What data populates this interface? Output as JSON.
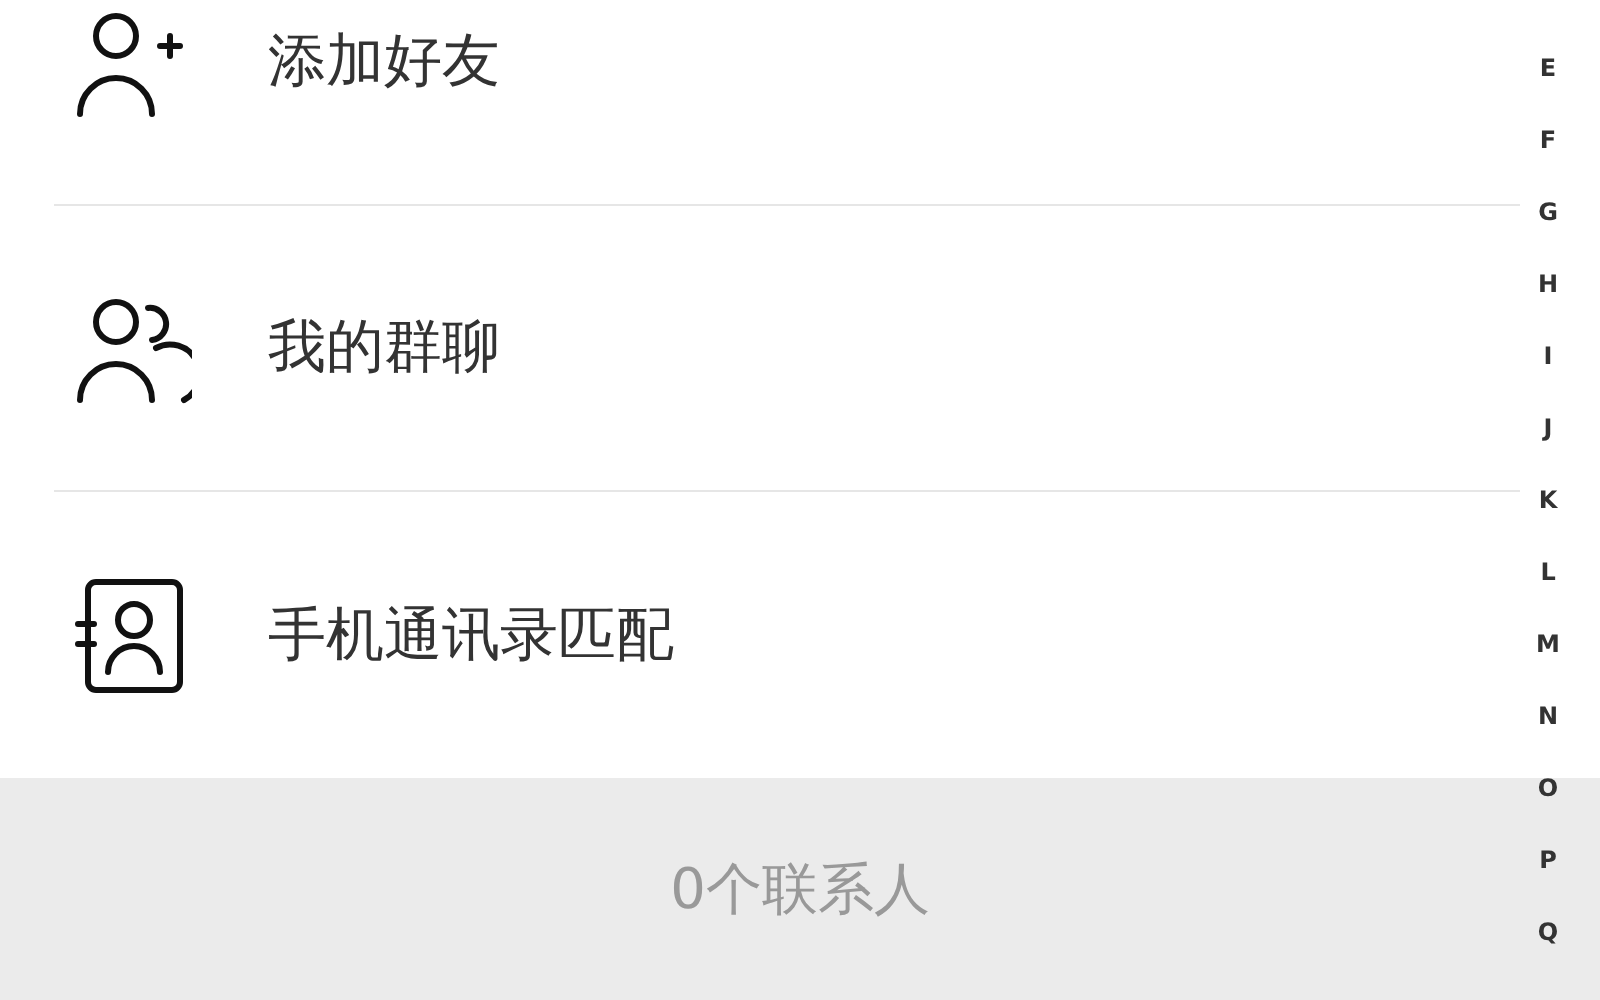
{
  "menu_items": [
    {
      "kind": "add-friend",
      "label": "添加好友"
    },
    {
      "kind": "group-chat",
      "label": "我的群聊"
    },
    {
      "kind": "contacts",
      "label": "手机通讯录匹配"
    }
  ],
  "footer": {
    "count": "0个联系人"
  },
  "index_letters": [
    "E",
    "F",
    "G",
    "H",
    "I",
    "J",
    "K",
    "L",
    "M",
    "N",
    "O",
    "P",
    "Q"
  ]
}
